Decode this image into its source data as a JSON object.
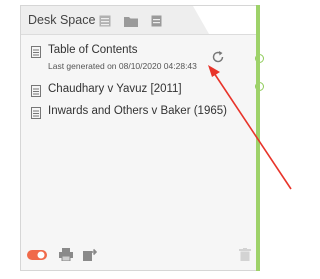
{
  "panel": {
    "title": "Desk Space"
  },
  "items": [
    {
      "label": "Table of Contents",
      "sub": "Last generated on 08/10/2020 04:28:43"
    },
    {
      "label": "Chaudhary v Yavuz [2011]"
    },
    {
      "label": "Inwards and Others v Baker (1965)"
    }
  ],
  "colors": {
    "accent": "#9ed26a",
    "toggle": "#f06a4a",
    "arrow": "#e8342a"
  }
}
